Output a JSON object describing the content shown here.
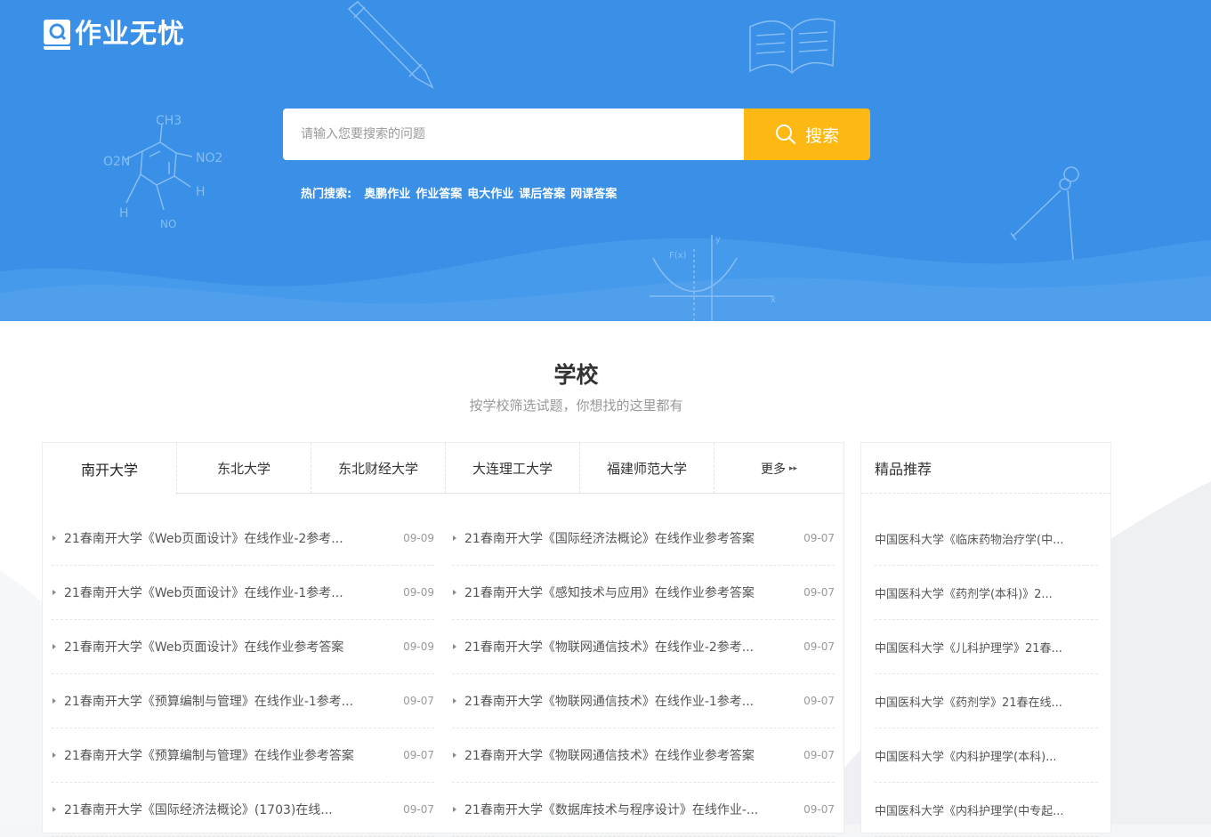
{
  "logo": {
    "text": "作业无忧"
  },
  "search": {
    "placeholder": "请输入您要搜索的问题",
    "button_label": "搜索",
    "hot_label": "热门搜索:",
    "hot_links": [
      "奥鹏作业",
      "作业答案",
      "电大作业",
      "课后答案",
      "网课答案"
    ]
  },
  "section": {
    "title": "学校",
    "subtitle": "按学校筛选试题，你想找的这里都有"
  },
  "tabs": [
    {
      "label": "南开大学",
      "active": true
    },
    {
      "label": "东北大学"
    },
    {
      "label": "东北财经大学"
    },
    {
      "label": "大连理工大学"
    },
    {
      "label": "福建师范大学"
    },
    {
      "label": "更多"
    }
  ],
  "columns": [
    [
      {
        "title": "21春南开大学《Web页面设计》在线作业-2参考...",
        "date": "09-09"
      },
      {
        "title": "21春南开大学《Web页面设计》在线作业-1参考...",
        "date": "09-09"
      },
      {
        "title": "21春南开大学《Web页面设计》在线作业参考答案",
        "date": "09-09"
      },
      {
        "title": "21春南开大学《预算编制与管理》在线作业-1参考...",
        "date": "09-07"
      },
      {
        "title": "21春南开大学《预算编制与管理》在线作业参考答案",
        "date": "09-07"
      },
      {
        "title": "21春南开大学《国际经济法概论》(1703)在线...",
        "date": "09-07"
      }
    ],
    [
      {
        "title": "21春南开大学《国际经济法概论》在线作业参考答案",
        "date": "09-07"
      },
      {
        "title": "21春南开大学《感知技术与应用》在线作业参考答案",
        "date": "09-07"
      },
      {
        "title": "21春南开大学《物联网通信技术》在线作业-2参考...",
        "date": "09-07"
      },
      {
        "title": "21春南开大学《物联网通信技术》在线作业-1参考...",
        "date": "09-07"
      },
      {
        "title": "21春南开大学《物联网通信技术》在线作业参考答案",
        "date": "09-07"
      },
      {
        "title": "21春南开大学《数据库技术与程序设计》在线作业-...",
        "date": "09-07"
      }
    ]
  ],
  "side": {
    "title": "精品推荐",
    "items": [
      "中国医科大学《临床药物治疗学(中...",
      "中国医科大学《药剂学(本科)》2...",
      "中国医科大学《儿科护理学》21春...",
      "中国医科大学《药剂学》21春在线...",
      "中国医科大学《内科护理学(本科)...",
      "中国医科大学《内科护理学(中专起..."
    ]
  },
  "colors": {
    "hero_bg": "#3a8fe6",
    "search_button": "#fdb813",
    "text_main": "#333333",
    "text_muted": "#999999"
  }
}
